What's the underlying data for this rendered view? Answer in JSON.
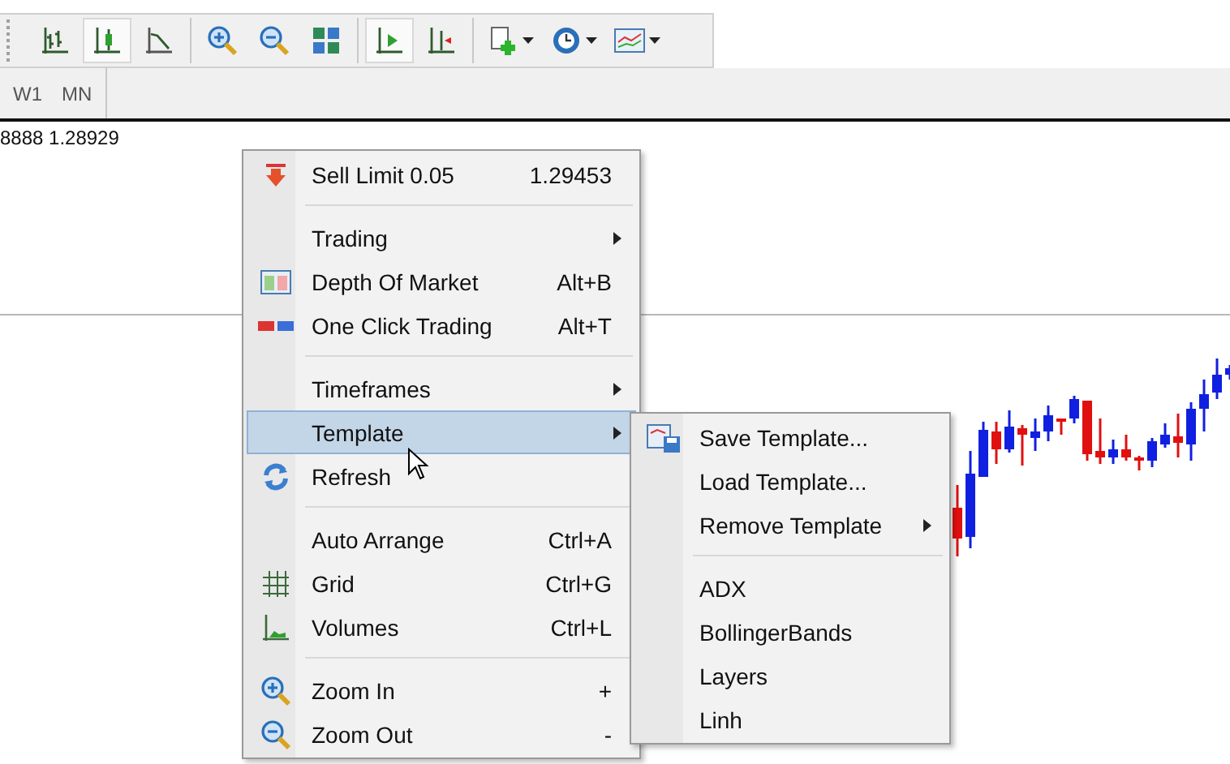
{
  "toolbar": {
    "groups": [
      [
        {
          "kind": "bars",
          "selected": false,
          "dropdown": false
        },
        {
          "kind": "candles",
          "selected": true,
          "dropdown": false
        },
        {
          "kind": "line",
          "selected": false,
          "dropdown": false
        }
      ],
      [
        {
          "kind": "zoomin",
          "selected": false,
          "dropdown": false
        },
        {
          "kind": "zoomout",
          "selected": false,
          "dropdown": false
        },
        {
          "kind": "tile",
          "selected": false,
          "dropdown": false
        }
      ],
      [
        {
          "kind": "autoscroll",
          "selected": true,
          "dropdown": false
        },
        {
          "kind": "shift",
          "selected": false,
          "dropdown": false
        }
      ],
      [
        {
          "kind": "newchart",
          "selected": false,
          "dropdown": true
        },
        {
          "kind": "clock",
          "selected": false,
          "dropdown": true
        },
        {
          "kind": "template",
          "selected": false,
          "dropdown": true
        }
      ]
    ]
  },
  "timeframes": [
    {
      "label": "W1"
    },
    {
      "label": "MN"
    }
  ],
  "chart": {
    "price_text": "8888 1.28929"
  },
  "context_menu": {
    "items": [
      {
        "kind": "item",
        "label": "Sell Limit 0.05",
        "shortcut": "1.29453",
        "submenu": false,
        "selected": false
      },
      {
        "kind": "separator"
      },
      {
        "kind": "item",
        "label": "Trading",
        "submenu": true,
        "selected": false
      },
      {
        "kind": "item",
        "label": "Depth Of Market",
        "shortcut": "Alt+B",
        "submenu": false,
        "selected": false
      },
      {
        "kind": "item",
        "label": "One Click Trading",
        "shortcut": "Alt+T",
        "submenu": false,
        "selected": false
      },
      {
        "kind": "separator"
      },
      {
        "kind": "item",
        "label": "Timeframes",
        "submenu": true,
        "selected": false
      },
      {
        "kind": "item",
        "label": "Template",
        "submenu": true,
        "selected": true
      },
      {
        "kind": "item",
        "label": "Refresh",
        "submenu": false,
        "selected": false
      },
      {
        "kind": "separator"
      },
      {
        "kind": "item",
        "label": "Auto Arrange",
        "shortcut": "Ctrl+A",
        "submenu": false,
        "selected": false
      },
      {
        "kind": "item",
        "label": "Grid",
        "shortcut": "Ctrl+G",
        "submenu": false,
        "selected": false
      },
      {
        "kind": "item",
        "label": "Volumes",
        "shortcut": "Ctrl+L",
        "submenu": false,
        "selected": false
      },
      {
        "kind": "separator"
      },
      {
        "kind": "item",
        "label": "Zoom In",
        "shortcut": "+",
        "submenu": false,
        "selected": false
      },
      {
        "kind": "item",
        "label": "Zoom Out",
        "shortcut": "-",
        "submenu": false,
        "selected": false
      }
    ]
  },
  "template_submenu": {
    "items": [
      {
        "kind": "item",
        "label": "Save Template...",
        "submenu": false,
        "selected": false
      },
      {
        "kind": "item",
        "label": "Load Template...",
        "submenu": false,
        "selected": false
      },
      {
        "kind": "item",
        "label": "Remove Template",
        "submenu": true,
        "selected": false
      },
      {
        "kind": "separator"
      },
      {
        "kind": "item",
        "label": "ADX",
        "submenu": false,
        "selected": false
      },
      {
        "kind": "item",
        "label": "BollingerBands",
        "submenu": false,
        "selected": false
      },
      {
        "kind": "item",
        "label": "Layers",
        "submenu": false,
        "selected": false
      },
      {
        "kind": "item",
        "label": "Linh",
        "submenu": false,
        "selected": false
      }
    ]
  }
}
